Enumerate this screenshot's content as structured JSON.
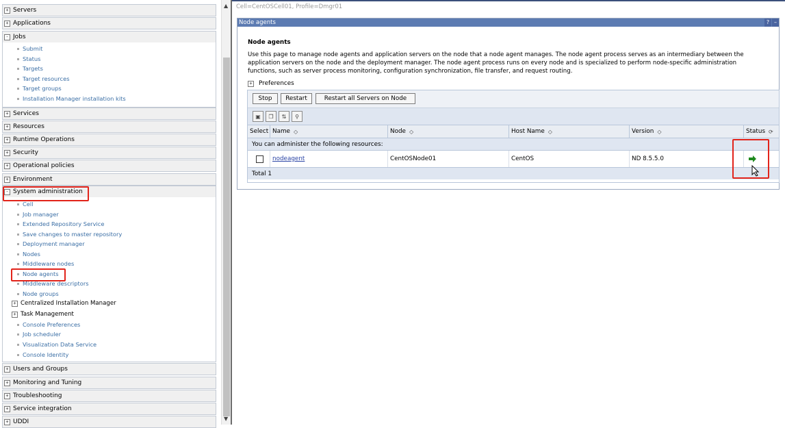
{
  "nav": {
    "sections": [
      {
        "label": "Servers",
        "expander": "+"
      },
      {
        "label": "Applications",
        "expander": "+"
      },
      {
        "label": "Jobs",
        "expander": "-"
      },
      {
        "label": "Services",
        "expander": "+"
      },
      {
        "label": "Resources",
        "expander": "+"
      },
      {
        "label": "Runtime Operations",
        "expander": "+"
      },
      {
        "label": "Security",
        "expander": "+"
      },
      {
        "label": "Operational policies",
        "expander": "+"
      },
      {
        "label": "Environment",
        "expander": "+"
      },
      {
        "label": "System administration",
        "expander": "-"
      },
      {
        "label": "Users and Groups",
        "expander": "+"
      },
      {
        "label": "Monitoring and Tuning",
        "expander": "+"
      },
      {
        "label": "Troubleshooting",
        "expander": "+"
      },
      {
        "label": "Service integration",
        "expander": "+"
      },
      {
        "label": "UDDI",
        "expander": "+"
      }
    ],
    "jobs_items": [
      "Submit",
      "Status",
      "Targets",
      "Target resources",
      "Target groups",
      "Installation Manager installation kits"
    ],
    "sysadmin_items": [
      "Cell",
      "Job manager",
      "Extended Repository Service",
      "Save changes to master repository",
      "Deployment manager",
      "Nodes",
      "Middleware nodes",
      "Node agents",
      "Middleware descriptors",
      "Node groups"
    ],
    "sysadmin_groups": [
      {
        "label": "Centralized Installation Manager",
        "expander": "+"
      },
      {
        "label": "Task Management",
        "expander": "+"
      }
    ],
    "sysadmin_items2": [
      "Console Preferences",
      "Job scheduler",
      "Visualization Data Service",
      "Console Identity"
    ]
  },
  "breadcrumb": "Cell=CentOSCell01, Profile=Dmgr01",
  "panel": {
    "header": "Node agents",
    "help": "?",
    "minimize": "–",
    "title": "Node agents",
    "description": "Use this page to manage node agents and application servers on the node that a node agent manages. The node agent process serves as an intermediary between the application servers on the node and the deployment manager. The node agent process runs on every node and is specialized to perform node-specific administration functions, such as server process monitoring, configuration synchronization, file transfer, and request routing.",
    "preferences": "Preferences",
    "preferences_expander": "+"
  },
  "buttons": {
    "stop": "Stop",
    "restart": "Restart",
    "restart_all": "Restart all Servers on Node"
  },
  "table": {
    "columns": [
      "Select",
      "Name",
      "Node",
      "Host Name",
      "Version",
      "Status"
    ],
    "resources_caption": "You can administer the following resources:",
    "rows": [
      {
        "name": "nodeagent",
        "node": "CentOSNode01",
        "host": "CentOS",
        "version": "ND 8.5.5.0",
        "status": "started"
      }
    ],
    "total": "Total 1"
  },
  "colors": {
    "status_green": "#1f8a1f",
    "highlight_red": "#e2231a",
    "panel_header": "#5c7bb2",
    "link": "#3a6ea5"
  }
}
